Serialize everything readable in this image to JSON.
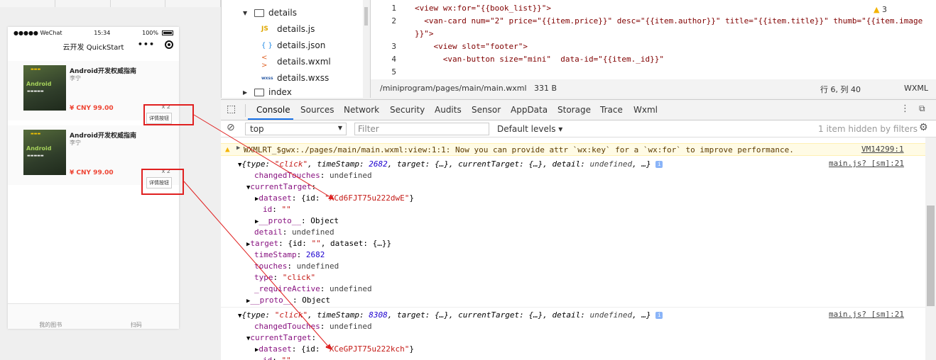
{
  "simulator": {
    "carrier": "●●●●● WeChat",
    "time": "15:34",
    "battery": "100%",
    "nav_title": "云开发 QuickStart",
    "capsule_dots": "•••",
    "books": [
      {
        "title": "Android开发权威指南",
        "author": "李宁",
        "price": "¥ CNY 99.00",
        "num": "x 2",
        "button": "详情按钮"
      },
      {
        "title": "Android开发权威指南",
        "author": "李宁",
        "price": "¥ CNY 99.00",
        "num": "x 2",
        "button": "详情按钮"
      }
    ],
    "tabbar": [
      "我的图书",
      "扫码"
    ]
  },
  "file_tree": {
    "folder": "details",
    "files": [
      "details.js",
      "details.json",
      "details.wxml",
      "details.wxss"
    ],
    "next_folder": "index"
  },
  "editor": {
    "line_numbers": [
      "1",
      "2",
      "",
      "3",
      "4",
      "5"
    ],
    "lines": [
      "<view wx:for=\"{{book_list}}\">",
      "  <van-card num=\"2\" price=\"{{item.price}}\" desc=\"{{item.author}}\" title=\"{{item.title}}\" thumb=\"{{item.image",
      "}}\">",
      "    <view slot=\"footer\">",
      "      <van-button size=\"mini\"  data-id=\"{{item._id}}\"",
      ""
    ],
    "status_path": "/miniprogram/pages/main/main.wxml",
    "status_size": "331 B",
    "status_pos": "行 6, 列 40",
    "status_lang": "WXML"
  },
  "devtools": {
    "tabs": [
      "Console",
      "Sources",
      "Network",
      "Security",
      "Audits",
      "Sensor",
      "AppData",
      "Storage",
      "Trace",
      "Wxml"
    ],
    "active_tab": "Console",
    "warn_count": "3",
    "context": "top",
    "filter_placeholder": "Filter",
    "levels": "Default levels ▾",
    "hidden_note": "1 item hidden by filters"
  },
  "console": {
    "warning": "WXMLRT_$gwx:./pages/main/main.wxml:view:1:1: Now you can provide attr `wx:key` for a `wx:for` to improve performance.",
    "warning_src": "VM14299:1",
    "event1_src": "main.js? [sm]:21",
    "event1_dataset_id": "XCd6FJT75u222dwE",
    "event1_timestamp": "2682",
    "event2_src": "main.js? [sm]:21",
    "event2_timestamp": "8308",
    "event2_dataset_id": "XCeGPJT75u222kch"
  }
}
